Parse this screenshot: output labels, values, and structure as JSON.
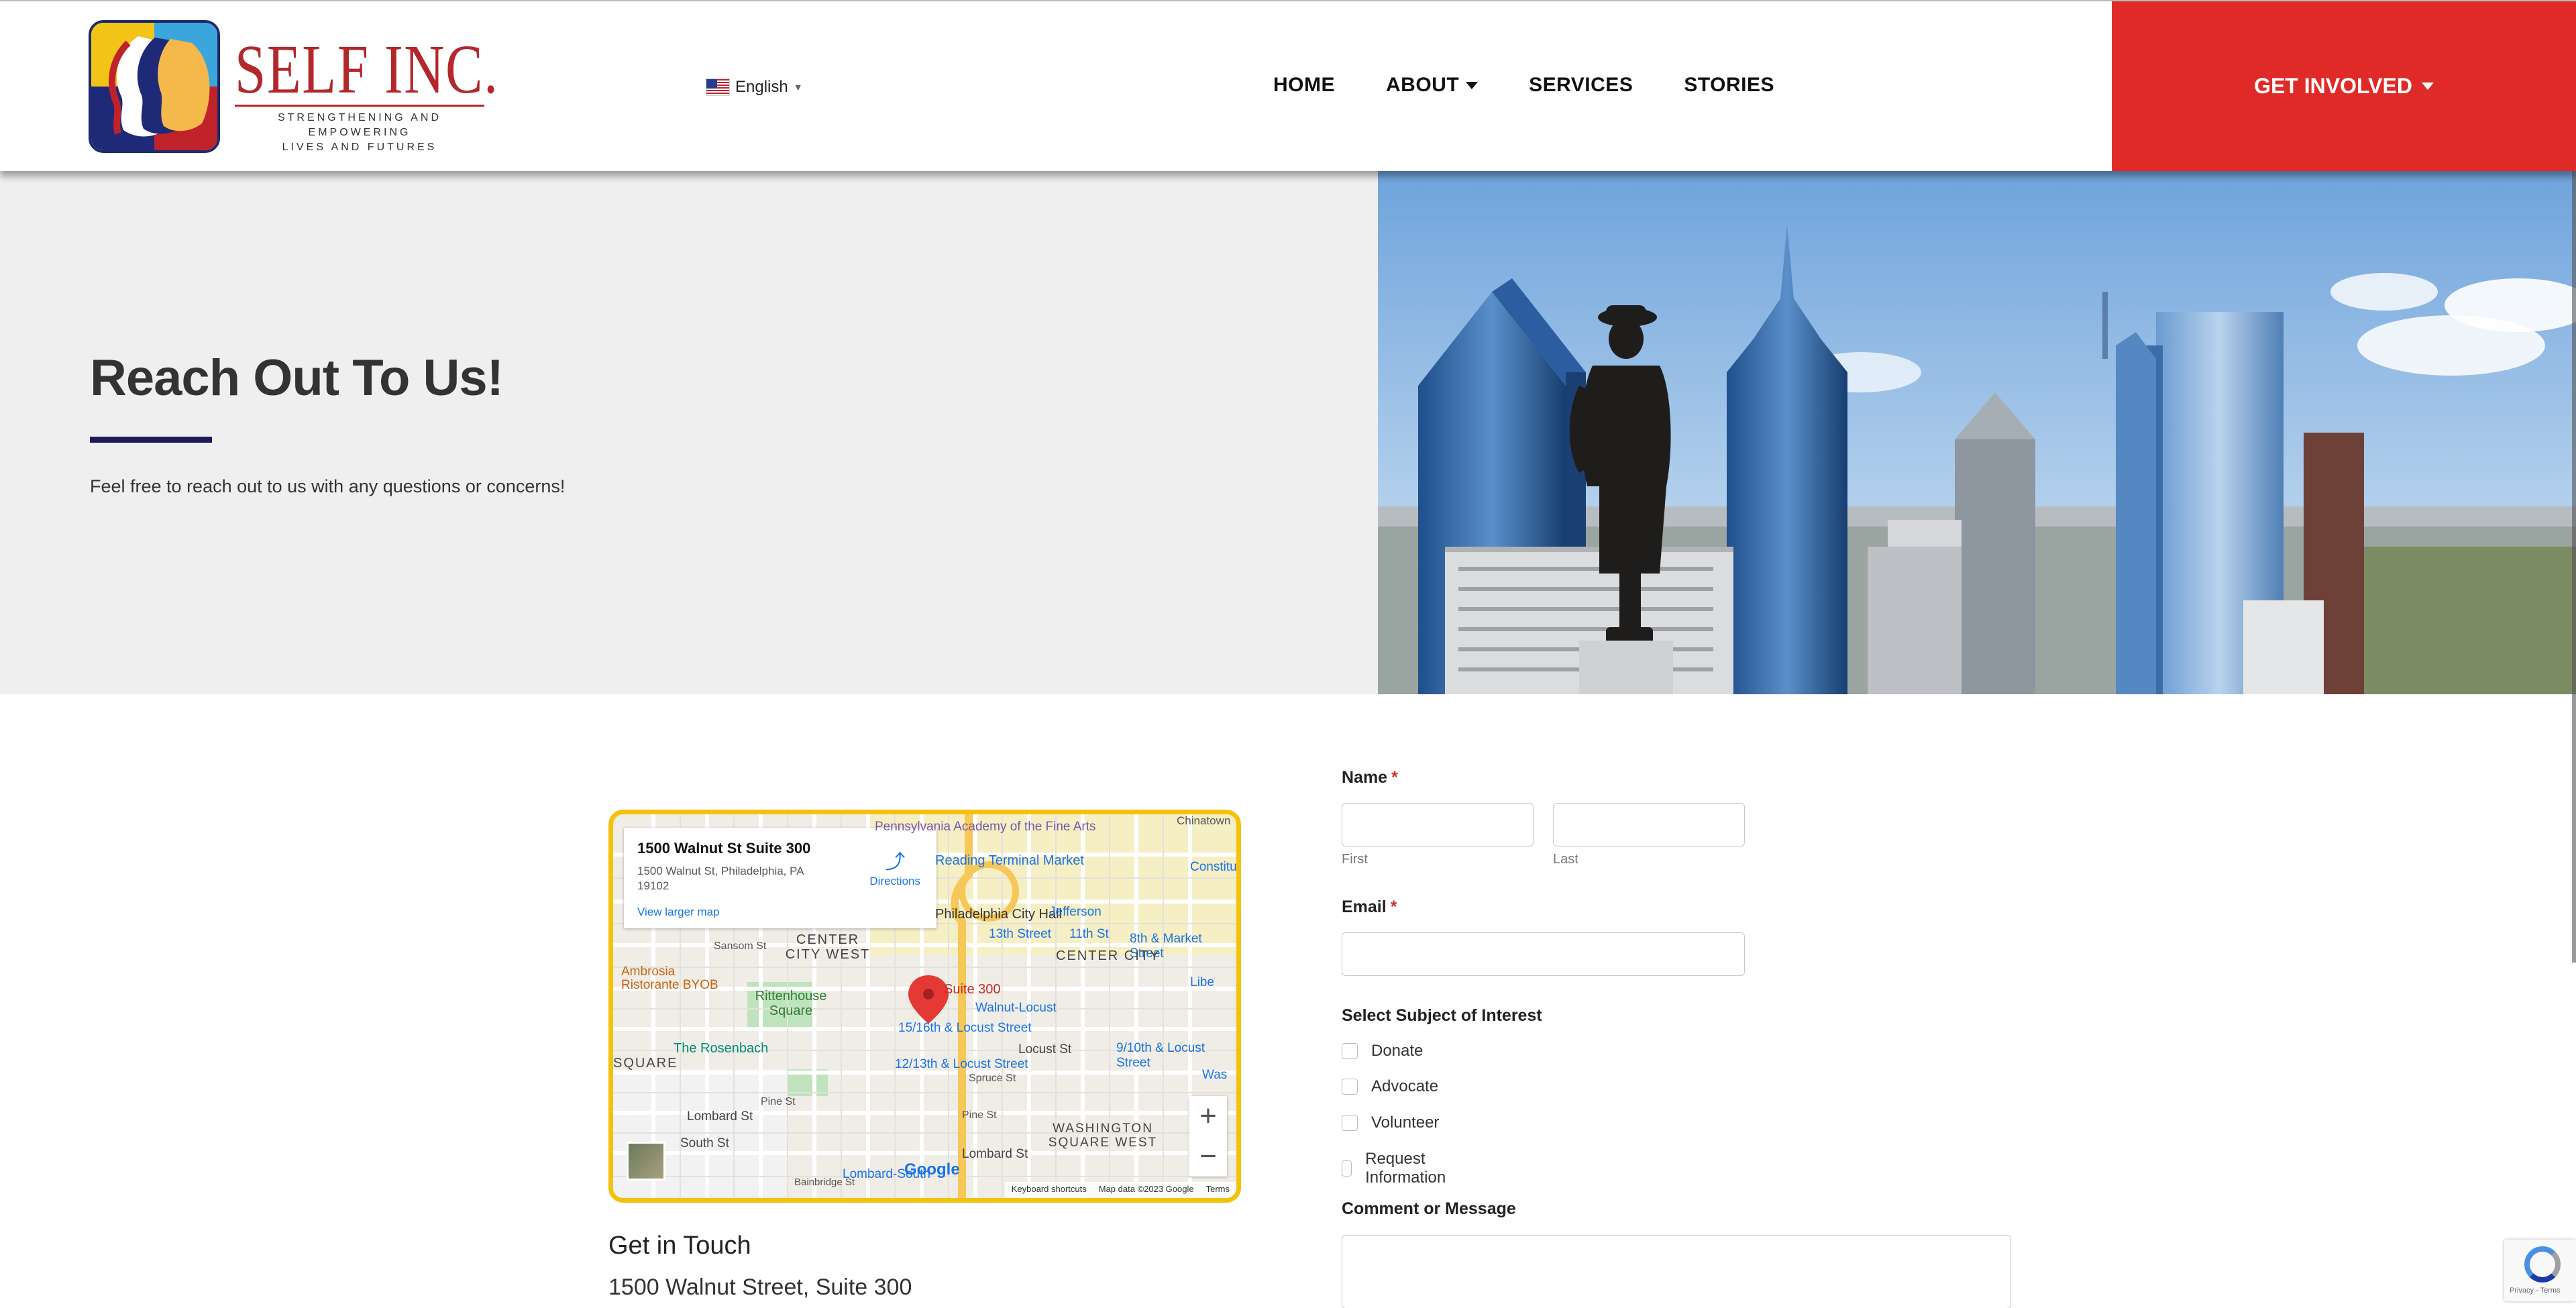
{
  "brand": {
    "name": "SELF INC.",
    "tagline_line1": "STRENGTHENING AND EMPOWERING",
    "tagline_line2": "LIVES AND FUTURES",
    "colors": {
      "red": "#e02a28",
      "navy": "#1e1a5a",
      "yellow": "#f4c20d"
    }
  },
  "language": {
    "label": "English",
    "icon": "us-flag-icon"
  },
  "nav": {
    "items": [
      {
        "label": "HOME",
        "dropdown": false
      },
      {
        "label": "ABOUT",
        "dropdown": true
      },
      {
        "label": "SERVICES",
        "dropdown": false
      },
      {
        "label": "STORIES",
        "dropdown": false
      }
    ],
    "cta": {
      "label": "GET INVOLVED"
    }
  },
  "hero": {
    "title": "Reach Out To Us!",
    "subtitle": "Feel free to reach out to us with any questions or concerns!"
  },
  "map": {
    "place_title": "1500 Walnut St Suite 300",
    "place_address": "1500 Walnut St, Philadelphia, PA 19102",
    "larger_map": "View larger map",
    "directions": "Directions",
    "pin_label": "Suite 300",
    "labels": {
      "pafa": "Pennsylvania Academy of the Fine Arts",
      "rtm": "Reading Terminal Market",
      "city_hall": "Philadelphia City Hall",
      "constitution": "Constitu",
      "chinatown": "Chinatown",
      "jefferson": "Jefferson",
      "thirteenth": "13th Street",
      "eleventh": "11th St",
      "eighth_market": "8th & Market Street",
      "sansom": "Sansom St",
      "ccw": "CENTER CITY WEST",
      "cc": "CENTER CITY",
      "ambrosia": "Ambrosia Ristorante BYOB",
      "rittenhouse": "Rittenhouse Square",
      "walnut_locust": "Walnut-Locust",
      "sixteenth_locust": "15/16th & Locust Street",
      "twelfth_locust": "12/13th & Locust Street",
      "ninth_locust": "9/10th & Locust Street",
      "locust_st": "Locust St",
      "rosenbach": "The Rosenbach",
      "square": "SQUARE",
      "lombard": "Lombard St",
      "lombard_south": "Lombard-South",
      "south_st": "South St",
      "pine_st": "Pine St",
      "spruce_st": "Spruce St",
      "wsw": "WASHINGTON SQUARE WEST",
      "bainbridge": "Bainbridge St",
      "liberty": "Libe",
      "was": "Was",
      "google": "Google"
    },
    "footer": {
      "shortcuts": "Keyboard shortcuts",
      "data": "Map data ©2023 Google",
      "terms": "Terms"
    }
  },
  "contact": {
    "title": "Get in Touch",
    "address": "1500 Walnut Street, Suite 300"
  },
  "form": {
    "name_label": "Name",
    "required_mark": "*",
    "first_label": "First",
    "last_label": "Last",
    "email_label": "Email",
    "subject_label": "Select Subject of Interest",
    "options": [
      "Donate",
      "Advocate",
      "Volunteer",
      "Request Information"
    ],
    "comment_label": "Comment or Message"
  },
  "recaptcha": {
    "text": "Privacy - Terms"
  }
}
